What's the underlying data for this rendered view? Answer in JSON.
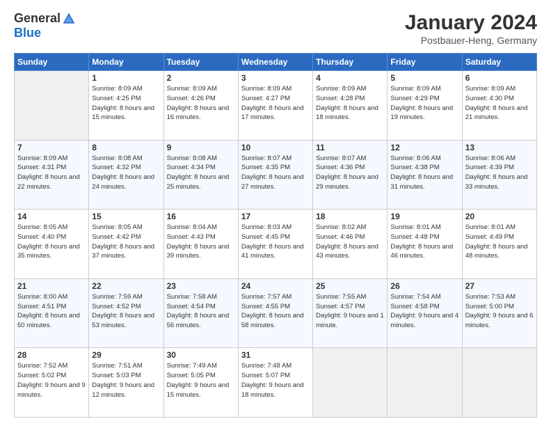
{
  "header": {
    "logo": {
      "general": "General",
      "blue": "Blue"
    },
    "title": "January 2024",
    "location": "Postbauer-Heng, Germany"
  },
  "weekdays": [
    "Sunday",
    "Monday",
    "Tuesday",
    "Wednesday",
    "Thursday",
    "Friday",
    "Saturday"
  ],
  "weeks": [
    [
      {
        "day": "",
        "sunrise": "",
        "sunset": "",
        "daylight": ""
      },
      {
        "day": "1",
        "sunrise": "Sunrise: 8:09 AM",
        "sunset": "Sunset: 4:25 PM",
        "daylight": "Daylight: 8 hours and 15 minutes."
      },
      {
        "day": "2",
        "sunrise": "Sunrise: 8:09 AM",
        "sunset": "Sunset: 4:26 PM",
        "daylight": "Daylight: 8 hours and 16 minutes."
      },
      {
        "day": "3",
        "sunrise": "Sunrise: 8:09 AM",
        "sunset": "Sunset: 4:27 PM",
        "daylight": "Daylight: 8 hours and 17 minutes."
      },
      {
        "day": "4",
        "sunrise": "Sunrise: 8:09 AM",
        "sunset": "Sunset: 4:28 PM",
        "daylight": "Daylight: 8 hours and 18 minutes."
      },
      {
        "day": "5",
        "sunrise": "Sunrise: 8:09 AM",
        "sunset": "Sunset: 4:29 PM",
        "daylight": "Daylight: 8 hours and 19 minutes."
      },
      {
        "day": "6",
        "sunrise": "Sunrise: 8:09 AM",
        "sunset": "Sunset: 4:30 PM",
        "daylight": "Daylight: 8 hours and 21 minutes."
      }
    ],
    [
      {
        "day": "7",
        "sunrise": "Sunrise: 8:09 AM",
        "sunset": "Sunset: 4:31 PM",
        "daylight": "Daylight: 8 hours and 22 minutes."
      },
      {
        "day": "8",
        "sunrise": "Sunrise: 8:08 AM",
        "sunset": "Sunset: 4:32 PM",
        "daylight": "Daylight: 8 hours and 24 minutes."
      },
      {
        "day": "9",
        "sunrise": "Sunrise: 8:08 AM",
        "sunset": "Sunset: 4:34 PM",
        "daylight": "Daylight: 8 hours and 25 minutes."
      },
      {
        "day": "10",
        "sunrise": "Sunrise: 8:07 AM",
        "sunset": "Sunset: 4:35 PM",
        "daylight": "Daylight: 8 hours and 27 minutes."
      },
      {
        "day": "11",
        "sunrise": "Sunrise: 8:07 AM",
        "sunset": "Sunset: 4:36 PM",
        "daylight": "Daylight: 8 hours and 29 minutes."
      },
      {
        "day": "12",
        "sunrise": "Sunrise: 8:06 AM",
        "sunset": "Sunset: 4:38 PM",
        "daylight": "Daylight: 8 hours and 31 minutes."
      },
      {
        "day": "13",
        "sunrise": "Sunrise: 8:06 AM",
        "sunset": "Sunset: 4:39 PM",
        "daylight": "Daylight: 8 hours and 33 minutes."
      }
    ],
    [
      {
        "day": "14",
        "sunrise": "Sunrise: 8:05 AM",
        "sunset": "Sunset: 4:40 PM",
        "daylight": "Daylight: 8 hours and 35 minutes."
      },
      {
        "day": "15",
        "sunrise": "Sunrise: 8:05 AM",
        "sunset": "Sunset: 4:42 PM",
        "daylight": "Daylight: 8 hours and 37 minutes."
      },
      {
        "day": "16",
        "sunrise": "Sunrise: 8:04 AM",
        "sunset": "Sunset: 4:43 PM",
        "daylight": "Daylight: 8 hours and 39 minutes."
      },
      {
        "day": "17",
        "sunrise": "Sunrise: 8:03 AM",
        "sunset": "Sunset: 4:45 PM",
        "daylight": "Daylight: 8 hours and 41 minutes."
      },
      {
        "day": "18",
        "sunrise": "Sunrise: 8:02 AM",
        "sunset": "Sunset: 4:46 PM",
        "daylight": "Daylight: 8 hours and 43 minutes."
      },
      {
        "day": "19",
        "sunrise": "Sunrise: 8:01 AM",
        "sunset": "Sunset: 4:48 PM",
        "daylight": "Daylight: 8 hours and 46 minutes."
      },
      {
        "day": "20",
        "sunrise": "Sunrise: 8:01 AM",
        "sunset": "Sunset: 4:49 PM",
        "daylight": "Daylight: 8 hours and 48 minutes."
      }
    ],
    [
      {
        "day": "21",
        "sunrise": "Sunrise: 8:00 AM",
        "sunset": "Sunset: 4:51 PM",
        "daylight": "Daylight: 8 hours and 50 minutes."
      },
      {
        "day": "22",
        "sunrise": "Sunrise: 7:59 AM",
        "sunset": "Sunset: 4:52 PM",
        "daylight": "Daylight: 8 hours and 53 minutes."
      },
      {
        "day": "23",
        "sunrise": "Sunrise: 7:58 AM",
        "sunset": "Sunset: 4:54 PM",
        "daylight": "Daylight: 8 hours and 56 minutes."
      },
      {
        "day": "24",
        "sunrise": "Sunrise: 7:57 AM",
        "sunset": "Sunset: 4:55 PM",
        "daylight": "Daylight: 8 hours and 58 minutes."
      },
      {
        "day": "25",
        "sunrise": "Sunrise: 7:55 AM",
        "sunset": "Sunset: 4:57 PM",
        "daylight": "Daylight: 9 hours and 1 minute."
      },
      {
        "day": "26",
        "sunrise": "Sunrise: 7:54 AM",
        "sunset": "Sunset: 4:58 PM",
        "daylight": "Daylight: 9 hours and 4 minutes."
      },
      {
        "day": "27",
        "sunrise": "Sunrise: 7:53 AM",
        "sunset": "Sunset: 5:00 PM",
        "daylight": "Daylight: 9 hours and 6 minutes."
      }
    ],
    [
      {
        "day": "28",
        "sunrise": "Sunrise: 7:52 AM",
        "sunset": "Sunset: 5:02 PM",
        "daylight": "Daylight: 9 hours and 9 minutes."
      },
      {
        "day": "29",
        "sunrise": "Sunrise: 7:51 AM",
        "sunset": "Sunset: 5:03 PM",
        "daylight": "Daylight: 9 hours and 12 minutes."
      },
      {
        "day": "30",
        "sunrise": "Sunrise: 7:49 AM",
        "sunset": "Sunset: 5:05 PM",
        "daylight": "Daylight: 9 hours and 15 minutes."
      },
      {
        "day": "31",
        "sunrise": "Sunrise: 7:48 AM",
        "sunset": "Sunset: 5:07 PM",
        "daylight": "Daylight: 9 hours and 18 minutes."
      },
      {
        "day": "",
        "sunrise": "",
        "sunset": "",
        "daylight": ""
      },
      {
        "day": "",
        "sunrise": "",
        "sunset": "",
        "daylight": ""
      },
      {
        "day": "",
        "sunrise": "",
        "sunset": "",
        "daylight": ""
      }
    ]
  ]
}
